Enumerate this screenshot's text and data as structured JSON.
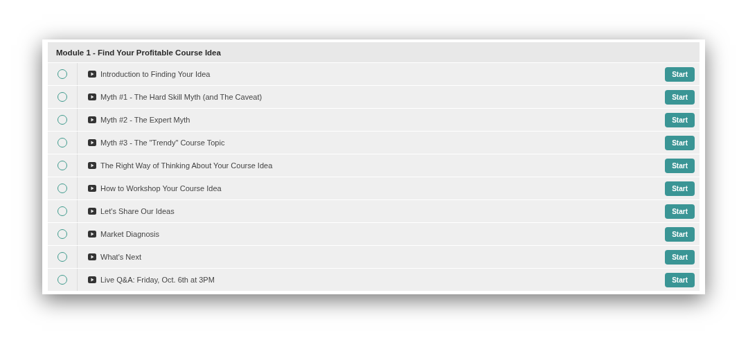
{
  "module": {
    "title": "Module 1 - Find Your Profitable Course Idea",
    "lessons": [
      {
        "title": "Introduction to Finding Your Idea",
        "completed": false,
        "button": "Start"
      },
      {
        "title": "Myth #1 - The Hard Skill Myth (and The Caveat)",
        "completed": false,
        "button": "Start"
      },
      {
        "title": "Myth #2 - The Expert Myth",
        "completed": false,
        "button": "Start"
      },
      {
        "title": "Myth #3 - The \"Trendy\" Course Topic",
        "completed": false,
        "button": "Start"
      },
      {
        "title": "The Right Way of Thinking About Your Course Idea",
        "completed": false,
        "button": "Start"
      },
      {
        "title": "How to Workshop Your Course Idea",
        "completed": false,
        "button": "Start"
      },
      {
        "title": "Let's Share Our Ideas",
        "completed": false,
        "button": "Start"
      },
      {
        "title": "Market Diagnosis",
        "completed": false,
        "button": "Start"
      },
      {
        "title": "What's Next",
        "completed": false,
        "button": "Start"
      },
      {
        "title": "Live Q&A: Friday, Oct. 6th at 3PM",
        "completed": false,
        "button": "Start"
      }
    ]
  }
}
